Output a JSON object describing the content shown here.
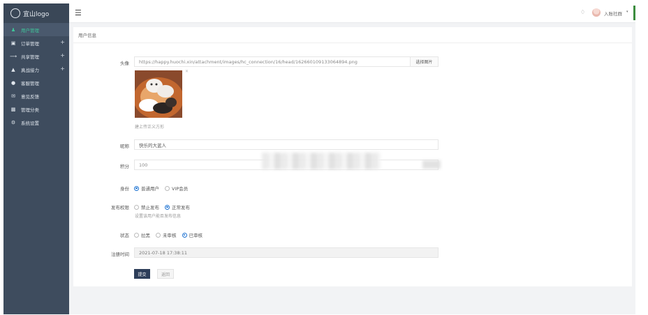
{
  "sidebar": {
    "logo_text": "宜山logo",
    "items": [
      {
        "label": "用户管理",
        "icon": "user-icon",
        "active": true,
        "expandable": false
      },
      {
        "label": "订单管理",
        "icon": "orders-icon",
        "active": false,
        "expandable": true
      },
      {
        "label": "共享管理",
        "icon": "share-icon",
        "active": false,
        "expandable": true
      },
      {
        "label": "真战接力",
        "icon": "trophy-icon",
        "active": false,
        "expandable": true
      },
      {
        "label": "客服管理",
        "icon": "chat-icon",
        "active": false,
        "expandable": false
      },
      {
        "label": "意见反馈",
        "icon": "mail-icon",
        "active": false,
        "expandable": false
      },
      {
        "label": "管理分类",
        "icon": "hierarchy-icon",
        "active": false,
        "expandable": false
      },
      {
        "label": "系统设置",
        "icon": "gears-icon",
        "active": false,
        "expandable": false
      }
    ]
  },
  "topbar": {
    "username": "入账社群",
    "caret": "▾"
  },
  "card": {
    "title": "用户信息",
    "avatar_label": "头像",
    "avatar_url": "https://happy.huochi.xin/attachment/images/hc_connection/16/head/16266010913306489​4.png",
    "pick_image_label": "选择图片",
    "avatar_hint": "建上传正义方形",
    "nickname_label": "昵称",
    "nickname_value": "快乐的大蓝人",
    "points_label": "积分",
    "points_value": "100",
    "identity_label": "身份",
    "identity_options": [
      {
        "label": "普通用户",
        "checked": true
      },
      {
        "label": "VIP会员",
        "checked": false
      }
    ],
    "publish_label": "发布权限",
    "publish_options": [
      {
        "label": "禁止发布",
        "checked": false
      },
      {
        "label": "正常发布",
        "checked": true
      }
    ],
    "publish_hint": "设置该用户能否发布信息",
    "status_label": "状态",
    "status_options": [
      {
        "label": "拉黑",
        "checked": false
      },
      {
        "label": "未审核",
        "checked": false
      },
      {
        "label": "已审核",
        "checked": true
      }
    ],
    "register_label": "注册时间",
    "register_value": "2021-07-18 17:38:11",
    "submit_label": "提交",
    "back_label": "返回"
  },
  "colors": {
    "sidebar_bg": "#3e4c5e",
    "active_text": "#3fc59a",
    "primary_button": "#2d3e59",
    "radio_checked": "#1e73d2"
  }
}
